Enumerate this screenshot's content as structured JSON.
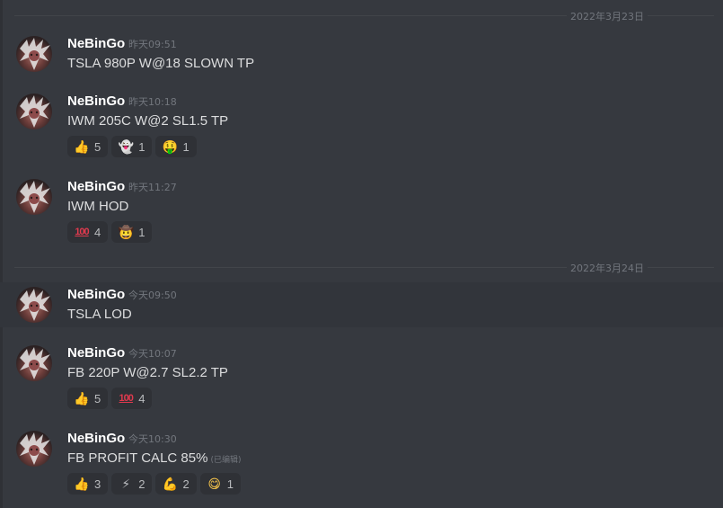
{
  "dates": {
    "d1": "2022年3月23日",
    "d2": "2022年3月24日"
  },
  "messages": [
    {
      "author": "NeBinGo",
      "time": "昨天09:51",
      "text": "TSLA 980P W@18 SLOWN TP",
      "reactions": []
    },
    {
      "author": "NeBinGo",
      "time": "昨天10:18",
      "text": "IWM 205C W@2 SL1.5 TP",
      "reactions": [
        {
          "icon": "thumbs-up-icon",
          "glyph": "👍",
          "count": "5"
        },
        {
          "icon": "ghost-icon",
          "glyph": "👻",
          "count": "1"
        },
        {
          "icon": "money-mouth-icon",
          "glyph": "🤑",
          "count": "1"
        }
      ]
    },
    {
      "author": "NeBinGo",
      "time": "昨天11:27",
      "text": "IWM HOD",
      "reactions": [
        {
          "icon": "hundred-points-icon",
          "glyph": "100",
          "count": "4"
        },
        {
          "icon": "cowboy-icon",
          "glyph": "🤠",
          "count": "1"
        }
      ]
    },
    {
      "author": "NeBinGo",
      "time": "今天09:50",
      "text": "TSLA LOD",
      "reactions": []
    },
    {
      "author": "NeBinGo",
      "time": "今天10:07",
      "text": "FB 220P W@2.7 SL2.2 TP",
      "reactions": [
        {
          "icon": "thumbs-up-icon",
          "glyph": "👍",
          "count": "5"
        },
        {
          "icon": "hundred-points-icon",
          "glyph": "100",
          "count": "4"
        }
      ]
    },
    {
      "author": "NeBinGo",
      "time": "今天10:30",
      "text": "FB PROFIT CALC 85%",
      "edited": "(已编辑)",
      "reactions": [
        {
          "icon": "thumbs-up-icon",
          "glyph": "👍",
          "count": "3"
        },
        {
          "icon": "lightning-icon",
          "glyph": "⚡",
          "count": "2"
        },
        {
          "icon": "flexed-biceps-icon",
          "glyph": "💪",
          "count": "2"
        },
        {
          "icon": "yum-face-icon",
          "glyph": "😋",
          "count": "1"
        }
      ]
    }
  ],
  "colors": {
    "background": "#36393f",
    "highlight": "#32353b",
    "reaction_bg": "#2f3136",
    "username": "#ffffff",
    "timestamp": "#72767d"
  }
}
